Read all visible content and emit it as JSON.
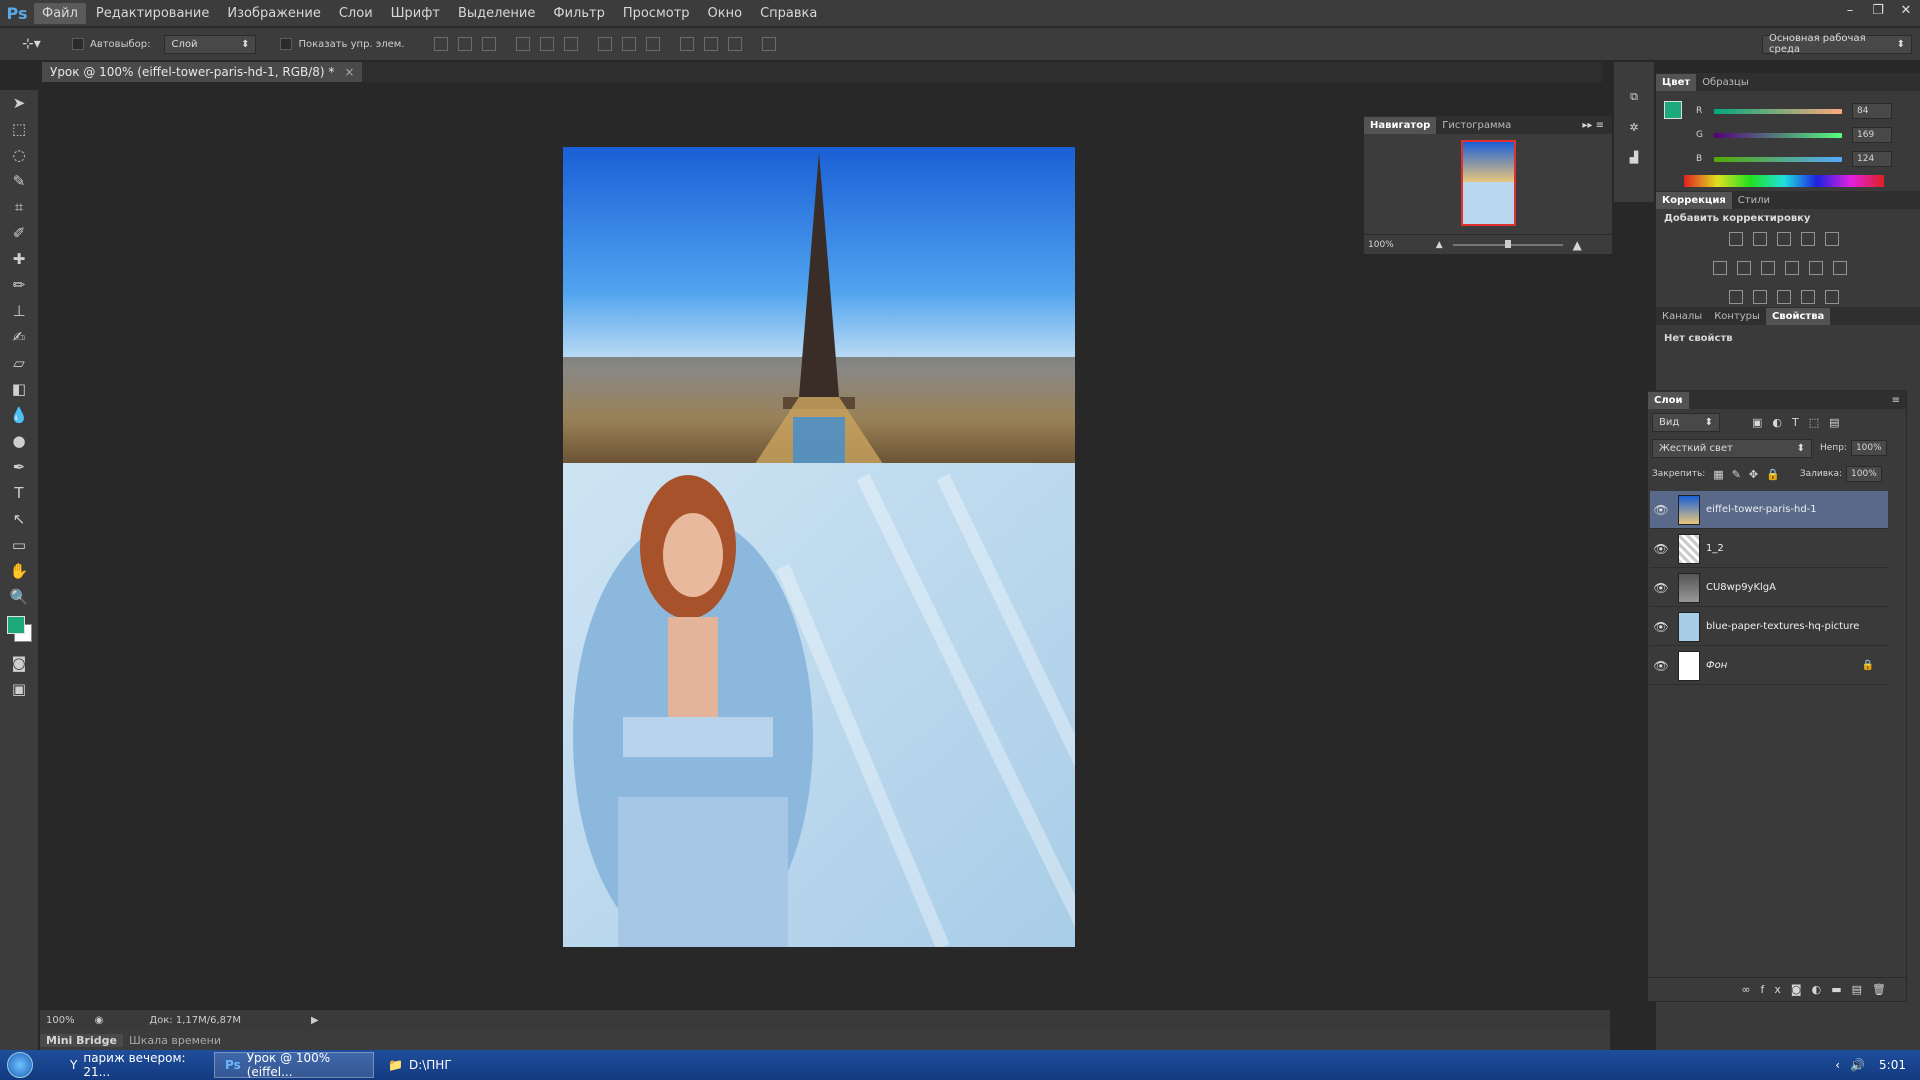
{
  "app": {
    "logo": "Ps"
  },
  "menu": [
    "Файл",
    "Редактирование",
    "Изображение",
    "Слои",
    "Шрифт",
    "Выделение",
    "Фильтр",
    "Просмотр",
    "Окно",
    "Справка"
  ],
  "options": {
    "autoselect_label": "Автовыбор:",
    "autoselect_value": "Слой",
    "show_transform_label": "Показать упр. элем.",
    "workspace": "Основная рабочая среда"
  },
  "document": {
    "tab_title": "Урок @ 100% (eiffel-tower-paris-hd-1, RGB/8) *",
    "close": "×"
  },
  "status": {
    "zoom": "100%",
    "doc": "Док: 1,17M/6,87M"
  },
  "bottom_tabs": [
    "Mini Bridge",
    "Шкала времени"
  ],
  "navigator": {
    "tabs": [
      "Навигатор",
      "Гистограмма"
    ],
    "zoom": "100%"
  },
  "color_panel": {
    "tabs": [
      "Цвет",
      "Образцы"
    ],
    "foreground": "#1da97c",
    "channels": [
      {
        "label": "R",
        "value": "84"
      },
      {
        "label": "G",
        "value": "169"
      },
      {
        "label": "B",
        "value": "124"
      }
    ]
  },
  "adjustments": {
    "tabs": [
      "Коррекция",
      "Стили"
    ],
    "title": "Добавить корректировку"
  },
  "properties": {
    "tabs": [
      "Каналы",
      "Контуры",
      "Свойства"
    ],
    "text": "Нет свойств"
  },
  "layers": {
    "title": "Слои",
    "filter": "Вид",
    "blend_mode": "Жесткий свет",
    "opacity_label": "Непр:",
    "opacity": "100%",
    "lock_label": "Закрепить:",
    "fill_label": "Заливка:",
    "fill": "100%",
    "items": [
      {
        "name": "eiffel-tower-paris-hd-1",
        "selected": true
      },
      {
        "name": "1_2",
        "selected": false
      },
      {
        "name": "CU8wp9yKlgA",
        "selected": false
      },
      {
        "name": "blue-paper-textures-hq-picture",
        "selected": false
      },
      {
        "name": "Фон",
        "selected": false
      }
    ]
  },
  "taskbar": {
    "items": [
      "париж вечером: 21...",
      "Урок @ 100% (eiffel...",
      "D:\\ПНГ"
    ],
    "clock": "5:01"
  }
}
